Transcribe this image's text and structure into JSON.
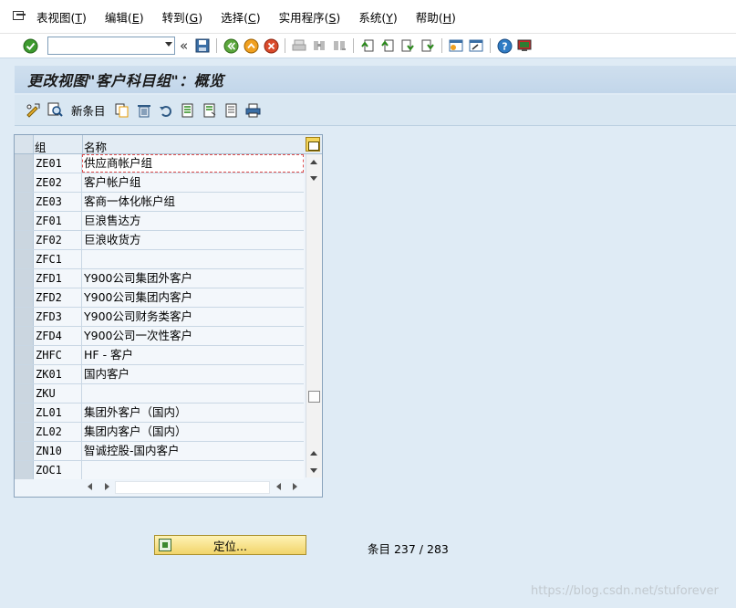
{
  "menu": {
    "items": [
      {
        "label": "表视图(",
        "acc": "T",
        "end": ")"
      },
      {
        "label": "编辑(",
        "acc": "E",
        "end": ")"
      },
      {
        "label": "转到(",
        "acc": "G",
        "end": ")"
      },
      {
        "label": "选择(",
        "acc": "C",
        "end": ")"
      },
      {
        "label": "实用程序(",
        "acc": "S",
        "end": ")"
      },
      {
        "label": "系统(",
        "acc": "Y",
        "end": ")"
      },
      {
        "label": "帮助(",
        "acc": "H",
        "end": ")"
      }
    ]
  },
  "toolbar": {
    "command_value": "",
    "chevron": "«"
  },
  "title": "更改视图\"客户科目组\"：概览",
  "app_toolbar": {
    "new_entries_label": "新条目"
  },
  "table": {
    "columns": {
      "code": "组",
      "name": "名称"
    },
    "rows": [
      {
        "code": "ZE01",
        "name": "供应商帐户组"
      },
      {
        "code": "ZE02",
        "name": "客户帐户组"
      },
      {
        "code": "ZE03",
        "name": "客商一体化帐户组"
      },
      {
        "code": "ZF01",
        "name": "巨浪售达方"
      },
      {
        "code": "ZF02",
        "name": "巨浪收货方"
      },
      {
        "code": "ZFC1",
        "name": ""
      },
      {
        "code": "ZFD1",
        "name": "Y900公司集团外客户"
      },
      {
        "code": "ZFD2",
        "name": "Y900公司集团内客户"
      },
      {
        "code": "ZFD3",
        "name": "Y900公司财务类客户"
      },
      {
        "code": "ZFD4",
        "name": "Y900公司一次性客户"
      },
      {
        "code": "ZHFC",
        "name": "HF - 客户"
      },
      {
        "code": "ZK01",
        "name": "国内客户"
      },
      {
        "code": "ZKU",
        "name": ""
      },
      {
        "code": "ZL01",
        "name": "集团外客户（国内）"
      },
      {
        "code": "ZL02",
        "name": "集团内客户（国内）"
      },
      {
        "code": "ZN10",
        "name": "智诚控股-国内客户"
      },
      {
        "code": "ZOC1",
        "name": ""
      }
    ]
  },
  "position_button_label": "定位...",
  "entry_count": "条目 237 / 283",
  "watermark": "https://blog.csdn.net/stuforever",
  "colors": {
    "background": "#dfebf5",
    "title_bar": "#c2d6ea",
    "position_button": "#f1d46a"
  }
}
